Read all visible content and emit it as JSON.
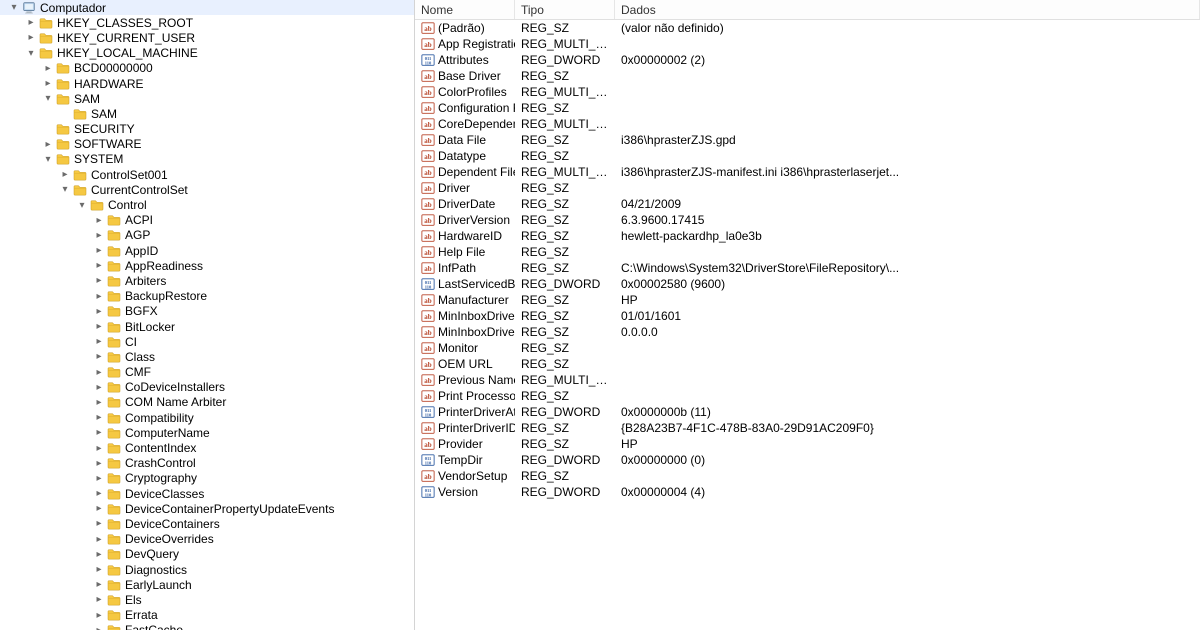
{
  "columns": {
    "name": "Nome",
    "type": "Tipo",
    "data": "Dados"
  },
  "tree": [
    {
      "level": 0,
      "toggle": "open",
      "icon": "computer",
      "label": "Computador"
    },
    {
      "level": 1,
      "toggle": "closed",
      "icon": "folder",
      "label": "HKEY_CLASSES_ROOT"
    },
    {
      "level": 1,
      "toggle": "closed",
      "icon": "folder",
      "label": "HKEY_CURRENT_USER"
    },
    {
      "level": 1,
      "toggle": "open",
      "icon": "folder",
      "label": "HKEY_LOCAL_MACHINE"
    },
    {
      "level": 2,
      "toggle": "closed",
      "icon": "folder",
      "label": "BCD00000000"
    },
    {
      "level": 2,
      "toggle": "closed",
      "icon": "folder",
      "label": "HARDWARE"
    },
    {
      "level": 2,
      "toggle": "open",
      "icon": "folder",
      "label": "SAM"
    },
    {
      "level": 3,
      "toggle": "none",
      "icon": "folder",
      "label": "SAM"
    },
    {
      "level": 2,
      "toggle": "none",
      "icon": "folder",
      "label": "SECURITY"
    },
    {
      "level": 2,
      "toggle": "closed",
      "icon": "folder",
      "label": "SOFTWARE"
    },
    {
      "level": 2,
      "toggle": "open",
      "icon": "folder",
      "label": "SYSTEM"
    },
    {
      "level": 3,
      "toggle": "closed",
      "icon": "folder",
      "label": "ControlSet001"
    },
    {
      "level": 3,
      "toggle": "open",
      "icon": "folder",
      "label": "CurrentControlSet"
    },
    {
      "level": 4,
      "toggle": "open",
      "icon": "folder",
      "label": "Control"
    },
    {
      "level": 5,
      "toggle": "closed",
      "icon": "folder",
      "label": "ACPI"
    },
    {
      "level": 5,
      "toggle": "closed",
      "icon": "folder",
      "label": "AGP"
    },
    {
      "level": 5,
      "toggle": "closed",
      "icon": "folder",
      "label": "AppID"
    },
    {
      "level": 5,
      "toggle": "closed",
      "icon": "folder",
      "label": "AppReadiness"
    },
    {
      "level": 5,
      "toggle": "closed",
      "icon": "folder",
      "label": "Arbiters"
    },
    {
      "level": 5,
      "toggle": "closed",
      "icon": "folder",
      "label": "BackupRestore"
    },
    {
      "level": 5,
      "toggle": "closed",
      "icon": "folder",
      "label": "BGFX"
    },
    {
      "level": 5,
      "toggle": "closed",
      "icon": "folder",
      "label": "BitLocker"
    },
    {
      "level": 5,
      "toggle": "closed",
      "icon": "folder",
      "label": "CI"
    },
    {
      "level": 5,
      "toggle": "closed",
      "icon": "folder",
      "label": "Class"
    },
    {
      "level": 5,
      "toggle": "closed",
      "icon": "folder",
      "label": "CMF"
    },
    {
      "level": 5,
      "toggle": "closed",
      "icon": "folder",
      "label": "CoDeviceInstallers"
    },
    {
      "level": 5,
      "toggle": "closed",
      "icon": "folder",
      "label": "COM Name Arbiter"
    },
    {
      "level": 5,
      "toggle": "closed",
      "icon": "folder",
      "label": "Compatibility"
    },
    {
      "level": 5,
      "toggle": "closed",
      "icon": "folder",
      "label": "ComputerName"
    },
    {
      "level": 5,
      "toggle": "closed",
      "icon": "folder",
      "label": "ContentIndex"
    },
    {
      "level": 5,
      "toggle": "closed",
      "icon": "folder",
      "label": "CrashControl"
    },
    {
      "level": 5,
      "toggle": "closed",
      "icon": "folder",
      "label": "Cryptography"
    },
    {
      "level": 5,
      "toggle": "closed",
      "icon": "folder",
      "label": "DeviceClasses"
    },
    {
      "level": 5,
      "toggle": "closed",
      "icon": "folder",
      "label": "DeviceContainerPropertyUpdateEvents"
    },
    {
      "level": 5,
      "toggle": "closed",
      "icon": "folder",
      "label": "DeviceContainers"
    },
    {
      "level": 5,
      "toggle": "closed",
      "icon": "folder",
      "label": "DeviceOverrides"
    },
    {
      "level": 5,
      "toggle": "closed",
      "icon": "folder",
      "label": "DevQuery"
    },
    {
      "level": 5,
      "toggle": "closed",
      "icon": "folder",
      "label": "Diagnostics"
    },
    {
      "level": 5,
      "toggle": "closed",
      "icon": "folder",
      "label": "EarlyLaunch"
    },
    {
      "level": 5,
      "toggle": "closed",
      "icon": "folder",
      "label": "Els"
    },
    {
      "level": 5,
      "toggle": "closed",
      "icon": "folder",
      "label": "Errata"
    },
    {
      "level": 5,
      "toggle": "closed",
      "icon": "folder",
      "label": "FastCache"
    }
  ],
  "values": [
    {
      "icon": "string",
      "name": "(Padrão)",
      "type": "REG_SZ",
      "data": "(valor não definido)"
    },
    {
      "icon": "string",
      "name": "App Registration",
      "type": "REG_MULTI_SZ",
      "data": ""
    },
    {
      "icon": "binary",
      "name": "Attributes",
      "type": "REG_DWORD",
      "data": "0x00000002 (2)"
    },
    {
      "icon": "string",
      "name": "Base Driver",
      "type": "REG_SZ",
      "data": ""
    },
    {
      "icon": "string",
      "name": "ColorProfiles",
      "type": "REG_MULTI_SZ",
      "data": ""
    },
    {
      "icon": "string",
      "name": "Configuration File",
      "type": "REG_SZ",
      "data": ""
    },
    {
      "icon": "string",
      "name": "CoreDependenc...",
      "type": "REG_MULTI_SZ",
      "data": ""
    },
    {
      "icon": "string",
      "name": "Data File",
      "type": "REG_SZ",
      "data": "i386\\hprasterZJS.gpd"
    },
    {
      "icon": "string",
      "name": "Datatype",
      "type": "REG_SZ",
      "data": ""
    },
    {
      "icon": "string",
      "name": "Dependent Files",
      "type": "REG_MULTI_SZ",
      "data": "i386\\hprasterZJS-manifest.ini i386\\hprasterlaserjet..."
    },
    {
      "icon": "string",
      "name": "Driver",
      "type": "REG_SZ",
      "data": ""
    },
    {
      "icon": "string",
      "name": "DriverDate",
      "type": "REG_SZ",
      "data": "04/21/2009"
    },
    {
      "icon": "string",
      "name": "DriverVersion",
      "type": "REG_SZ",
      "data": "6.3.9600.17415"
    },
    {
      "icon": "string",
      "name": "HardwareID",
      "type": "REG_SZ",
      "data": "hewlett-packardhp_la0e3b"
    },
    {
      "icon": "string",
      "name": "Help File",
      "type": "REG_SZ",
      "data": ""
    },
    {
      "icon": "string",
      "name": "InfPath",
      "type": "REG_SZ",
      "data": "C:\\Windows\\System32\\DriverStore\\FileRepository\\..."
    },
    {
      "icon": "binary",
      "name": "LastServicedBuild",
      "type": "REG_DWORD",
      "data": "0x00002580 (9600)"
    },
    {
      "icon": "string",
      "name": "Manufacturer",
      "type": "REG_SZ",
      "data": "HP"
    },
    {
      "icon": "string",
      "name": "MinInboxDriver...",
      "type": "REG_SZ",
      "data": "01/01/1601"
    },
    {
      "icon": "string",
      "name": "MinInboxDriver...",
      "type": "REG_SZ",
      "data": "0.0.0.0"
    },
    {
      "icon": "string",
      "name": "Monitor",
      "type": "REG_SZ",
      "data": ""
    },
    {
      "icon": "string",
      "name": "OEM URL",
      "type": "REG_SZ",
      "data": ""
    },
    {
      "icon": "string",
      "name": "Previous Names",
      "type": "REG_MULTI_SZ",
      "data": ""
    },
    {
      "icon": "string",
      "name": "Print Processor",
      "type": "REG_SZ",
      "data": ""
    },
    {
      "icon": "binary",
      "name": "PrinterDriverAttr...",
      "type": "REG_DWORD",
      "data": "0x0000000b (11)"
    },
    {
      "icon": "string",
      "name": "PrinterDriverID",
      "type": "REG_SZ",
      "data": "{B28A23B7-4F1C-478B-83A0-29D91AC209F0}"
    },
    {
      "icon": "string",
      "name": "Provider",
      "type": "REG_SZ",
      "data": "HP"
    },
    {
      "icon": "binary",
      "name": "TempDir",
      "type": "REG_DWORD",
      "data": "0x00000000 (0)"
    },
    {
      "icon": "string",
      "name": "VendorSetup",
      "type": "REG_SZ",
      "data": ""
    },
    {
      "icon": "binary",
      "name": "Version",
      "type": "REG_DWORD",
      "data": "0x00000004 (4)"
    }
  ]
}
